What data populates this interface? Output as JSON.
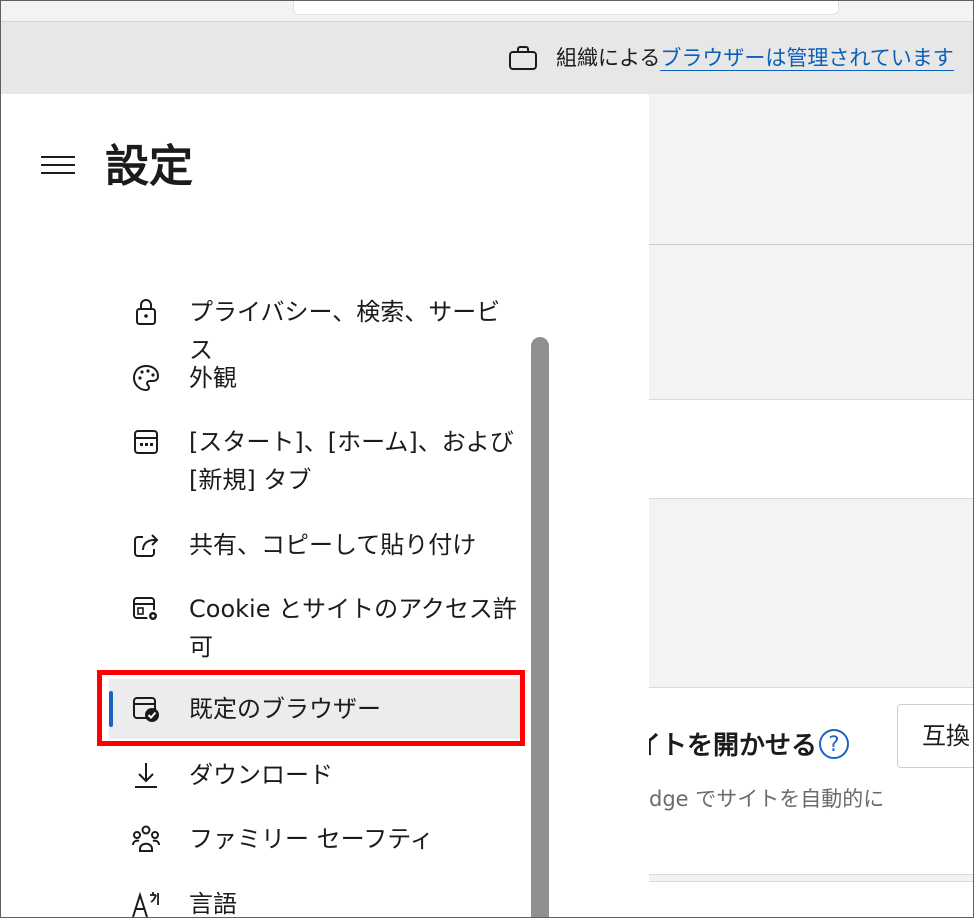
{
  "managed_bar": {
    "prefix": "組織による",
    "link": "ブラウザーは管理されています"
  },
  "settings": {
    "title": "設定",
    "nav": [
      {
        "label": "プライバシー、検索、サービス",
        "icon": "lock-icon",
        "selected": false
      },
      {
        "label": "外観",
        "icon": "palette-icon",
        "selected": false
      },
      {
        "label": "[スタート]、[ホーム]、および [新規] タブ",
        "icon": "new-tab-icon",
        "selected": false
      },
      {
        "label": "共有、コピーして貼り付け",
        "icon": "share-icon",
        "selected": false
      },
      {
        "label": "Cookie とサイトのアクセス許可",
        "icon": "site-permissions-icon",
        "selected": false
      },
      {
        "label": "既定のブラウザー",
        "icon": "default-browser-icon",
        "selected": true
      },
      {
        "label": "ダウンロード",
        "icon": "download-icon",
        "selected": false
      },
      {
        "label": "ファミリー セーフティ",
        "icon": "family-icon",
        "selected": false
      },
      {
        "label": "言語",
        "icon": "language-icon",
        "selected": false
      }
    ]
  },
  "content": {
    "heading_partial": "イトを開かせる",
    "help_symbol": "?",
    "description_partial": "dge でサイトを自動的に",
    "compat_button_partial": "互換"
  },
  "colors": {
    "accent": "#1a63c5",
    "highlight": "#ff0000",
    "managed_link": "#0f5fb8"
  }
}
